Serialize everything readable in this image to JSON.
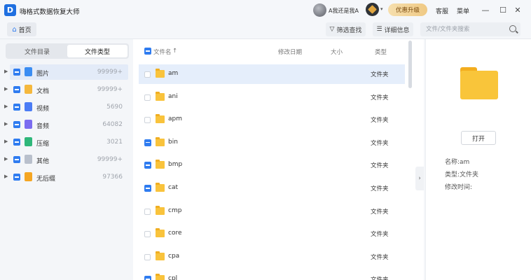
{
  "app": {
    "title": "嗨格式数据恢复大师",
    "logo_letter": "D"
  },
  "titlebar": {
    "user_name": "A我还是我A",
    "vip_caret": "▾",
    "promo_label": "优惠升级",
    "service_label": "客服",
    "menu_label": "菜单",
    "minimize": "—",
    "maximize": "☐",
    "close": "✕"
  },
  "toolbar": {
    "home_label": "首页",
    "filter_label": "筛选查找",
    "detail_label": "详细信息",
    "search_placeholder": "文件/文件夹搜索"
  },
  "sidebar": {
    "tabs": [
      "文件目录",
      "文件类型"
    ],
    "active_tab": 1,
    "categories": [
      {
        "label": "图片",
        "count": "99999+",
        "icon": "image-icon",
        "color": "#3b8df2"
      },
      {
        "label": "文档",
        "count": "99999+",
        "icon": "document-icon",
        "color": "#f5b83d"
      },
      {
        "label": "视频",
        "count": "5690",
        "icon": "video-icon",
        "color": "#4b7cf5"
      },
      {
        "label": "音频",
        "count": "64082",
        "icon": "audio-icon",
        "color": "#7b6cf0"
      },
      {
        "label": "压缩",
        "count": "3021",
        "icon": "archive-icon",
        "color": "#2fb77a"
      },
      {
        "label": "其他",
        "count": "99999+",
        "icon": "other-file-icon",
        "color": "#b9c0cc"
      },
      {
        "label": "无后缀",
        "count": "97366",
        "icon": "no-extension-icon",
        "color": "#f5a623"
      }
    ]
  },
  "filelist": {
    "headers": {
      "name": "文件名",
      "sort": "↑",
      "modified": "修改日期",
      "size": "大小",
      "type": "类型"
    },
    "rows": [
      {
        "name": "am",
        "type": "文件夹",
        "checked": false,
        "selected": true
      },
      {
        "name": "ani",
        "type": "文件夹",
        "checked": false,
        "selected": false
      },
      {
        "name": "apm",
        "type": "文件夹",
        "checked": false,
        "selected": false
      },
      {
        "name": "bin",
        "type": "文件夹",
        "checked": true,
        "selected": false
      },
      {
        "name": "bmp",
        "type": "文件夹",
        "checked": true,
        "selected": false
      },
      {
        "name": "cat",
        "type": "文件夹",
        "checked": true,
        "selected": false
      },
      {
        "name": "cmp",
        "type": "文件夹",
        "checked": false,
        "selected": false
      },
      {
        "name": "core",
        "type": "文件夹",
        "checked": false,
        "selected": false
      },
      {
        "name": "cpa",
        "type": "文件夹",
        "checked": false,
        "selected": false
      },
      {
        "name": "cpl",
        "type": "文件夹",
        "checked": true,
        "selected": false
      }
    ]
  },
  "detail": {
    "open_label": "打开",
    "name_line": "名称:am",
    "type_line": "类型:文件夹",
    "modified_line": "修改时间:"
  },
  "colors": {
    "accent": "#2f7cf0",
    "selection": "#e5eefb",
    "folder": "#f9c33c"
  }
}
